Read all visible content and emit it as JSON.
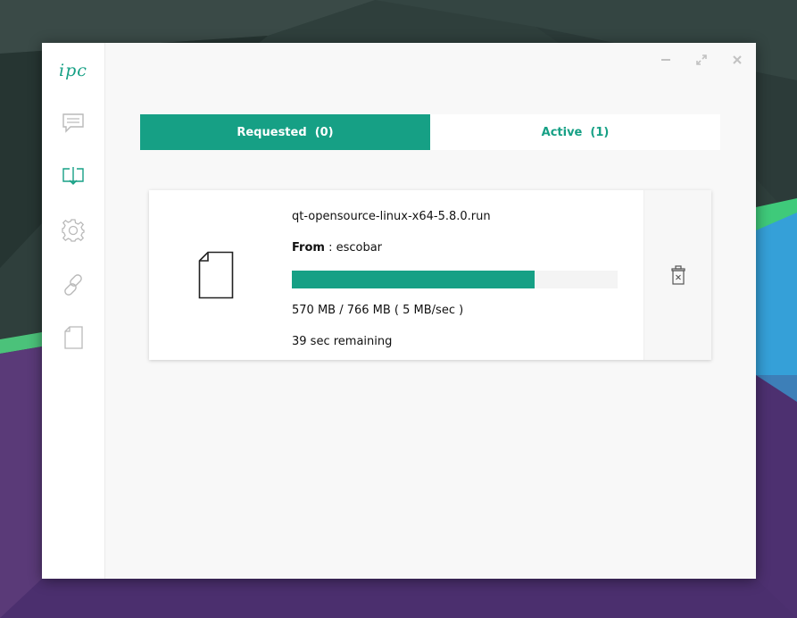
{
  "app": {
    "logo_text": "ipc",
    "accent_color": "#16a085"
  },
  "sidebar": {
    "items": [
      {
        "name": "messages",
        "icon": "chat-icon"
      },
      {
        "name": "downloads",
        "icon": "download-icon",
        "active": true
      },
      {
        "name": "settings",
        "icon": "gear-icon"
      },
      {
        "name": "links",
        "icon": "link-icon"
      },
      {
        "name": "files",
        "icon": "file-icon"
      }
    ]
  },
  "window_controls": {
    "minimize": "minimize-icon",
    "maximize": "expand-icon",
    "close": "close-icon"
  },
  "tabs": [
    {
      "label": "Requested  (0)",
      "active": true
    },
    {
      "label": "Active  (1)",
      "active": false
    }
  ],
  "transfer": {
    "file_name": "qt-opensource-linux-x64-5.8.0.run",
    "from_label": "From",
    "from_separator": " : ",
    "from_value": "escobar",
    "progress_fraction": 0.744,
    "size_text": "570 MB / 766 MB ( 5 MB/sec )",
    "remaining_text": "39 sec remaining",
    "delete_icon": "trash-icon"
  }
}
